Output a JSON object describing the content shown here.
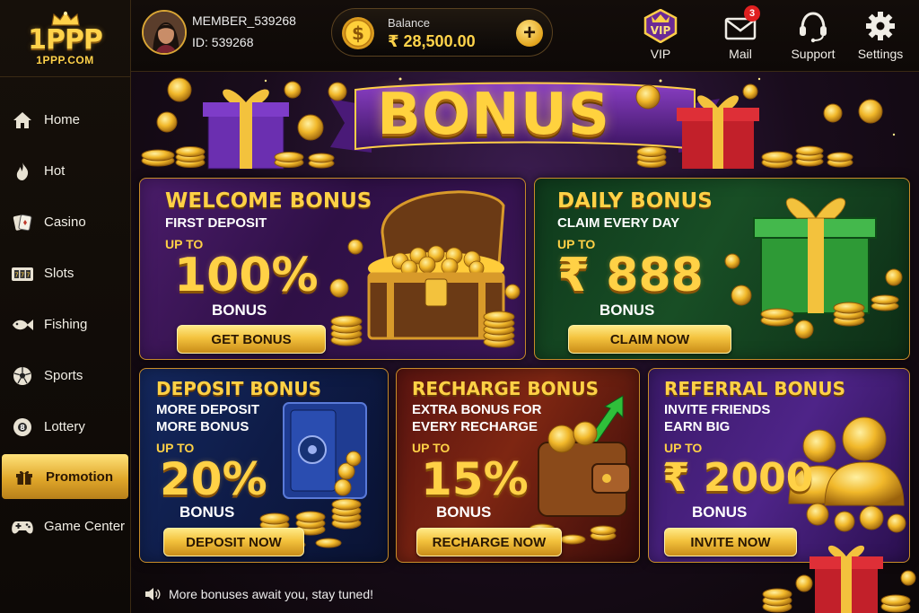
{
  "brand": {
    "logo_text": "1PPP",
    "logo_sub": "1PPP.COM"
  },
  "sidebar": {
    "items": [
      {
        "label": "Home",
        "icon": "home-icon",
        "active": false
      },
      {
        "label": "Hot",
        "icon": "flame-icon",
        "active": false
      },
      {
        "label": "Casino",
        "icon": "cards-icon",
        "active": false
      },
      {
        "label": "Slots",
        "icon": "slot-machine-icon",
        "active": false
      },
      {
        "label": "Fishing",
        "icon": "fish-icon",
        "active": false
      },
      {
        "label": "Sports",
        "icon": "soccer-ball-icon",
        "active": false
      },
      {
        "label": "Lottery",
        "icon": "lottery-ball-icon",
        "active": false
      },
      {
        "label": "Promotion",
        "icon": "gift-icon",
        "active": true
      },
      {
        "label": "Game Center",
        "icon": "gamepad-icon",
        "active": false
      }
    ]
  },
  "header": {
    "member_name": "MEMBER_539268",
    "member_id": "ID: 539268",
    "balance_label": "Balance",
    "balance_value": "₹ 28,500.00",
    "actions": [
      {
        "label": "VIP",
        "icon": "vip-badge-icon"
      },
      {
        "label": "Mail",
        "icon": "mail-icon",
        "badge": "3"
      },
      {
        "label": "Support",
        "icon": "headset-icon"
      },
      {
        "label": "Settings",
        "icon": "gear-icon"
      }
    ]
  },
  "banner": {
    "title": "BONUS"
  },
  "cards": {
    "welcome": {
      "title": "WELCOME BONUS",
      "sub": "FIRST DEPOSIT",
      "upto": "UP TO",
      "value": "100%",
      "bonus": "BONUS",
      "button": "GET BONUS"
    },
    "daily": {
      "title": "DAILY BONUS",
      "sub": "CLAIM EVERY DAY",
      "upto": "UP TO",
      "value": "₹ 888",
      "bonus": "BONUS",
      "button": "CLAIM NOW"
    },
    "deposit": {
      "title": "DEPOSIT BONUS",
      "sub1": "MORE DEPOSIT",
      "sub2": "MORE BONUS",
      "upto": "UP TO",
      "value": "20%",
      "bonus": "BONUS",
      "button": "DEPOSIT NOW"
    },
    "recharge": {
      "title": "RECHARGE BONUS",
      "sub1": "EXTRA BONUS FOR",
      "sub2": "EVERY RECHARGE",
      "upto": "UP TO",
      "value": "15%",
      "bonus": "BONUS",
      "button": "RECHARGE NOW"
    },
    "referral": {
      "title": "REFERRAL BONUS",
      "sub1": "INVITE FRIENDS",
      "sub2": "EARN BIG",
      "upto": "UP TO",
      "value": "₹ 2000",
      "bonus": "BONUS",
      "button": "INVITE NOW"
    }
  },
  "footer": {
    "notice": "More bonuses await you, stay tuned!"
  },
  "colors": {
    "gold": "#ffd146",
    "active_nav": "#e0a72a",
    "badge_red": "#e02020"
  }
}
